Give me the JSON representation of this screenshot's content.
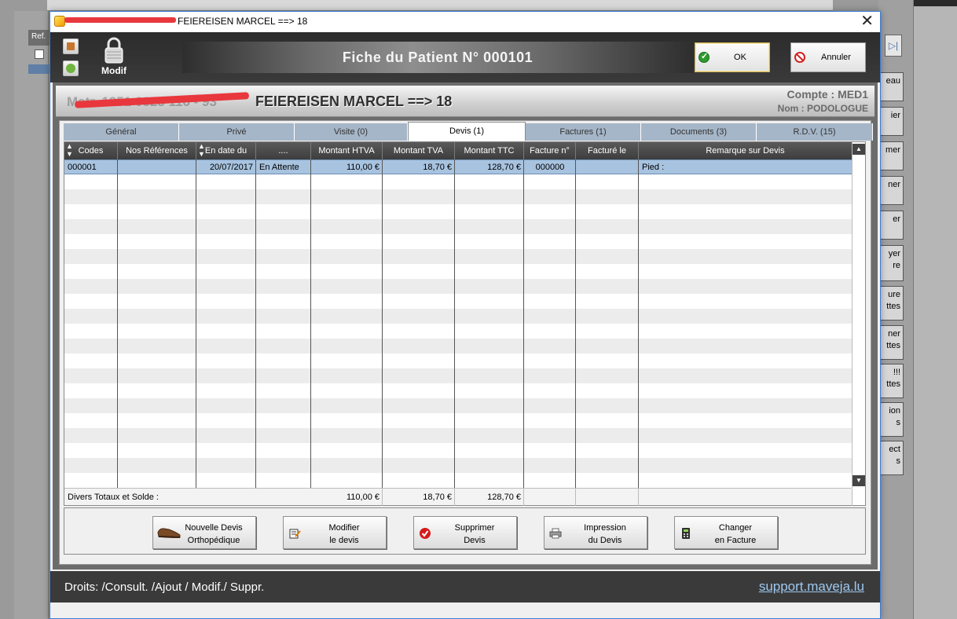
{
  "background": {
    "ref_tab": "Ref.",
    "nav_icon": "last-page-icon",
    "side_buttons": [
      {
        "line1": "eau",
        "line2": ""
      },
      {
        "line1": "ier",
        "line2": ""
      },
      {
        "line1": "mer",
        "line2": ""
      },
      {
        "line1": "ner",
        "line2": ""
      },
      {
        "line1": "er",
        "line2": ""
      },
      {
        "line1": "yer",
        "line2": "re"
      },
      {
        "line1": "ure",
        "line2": "ttes"
      },
      {
        "line1": "ner",
        "line2": "ttes"
      },
      {
        "line1": "!!!",
        "line2": "ttes"
      },
      {
        "line1": "ion",
        "line2": "s"
      },
      {
        "line1": "ect",
        "line2": "s"
      }
    ]
  },
  "window": {
    "title": "FEIEREISEN MARCEL ==> 18",
    "close": "✕"
  },
  "header": {
    "lock_label": "Modif",
    "banner": "Fiche du Patient N° 000101",
    "ok_label": "OK",
    "cancel_label": "Annuler"
  },
  "patient": {
    "ghost_prefix": "Matr. 1951 0823 116 - 93",
    "name": "FEIEREISEN MARCEL ==> 18",
    "compte": "Compte :  MED1",
    "nom": "Nom : PODOLOGUE"
  },
  "tabs": [
    "Général",
    "Privé",
    "Visite (0)",
    "Devis  (1)",
    "Factures (1)",
    "Documents (3)",
    "R.D.V. (15)"
  ],
  "grid": {
    "headers": [
      "Codes",
      "Nos Références",
      "En date du",
      "....",
      "Montant HTVA",
      "Montant TVA",
      "Montant TTC",
      "Facture n°",
      "Facturé le",
      "Remarque sur Devis"
    ],
    "rows": [
      [
        "000001",
        "",
        "20/07/2017",
        "En Attente",
        "110,00 €",
        "18,70 €",
        "128,70 €",
        "000000",
        "",
        "Pied :"
      ]
    ],
    "totals_label": "Divers Totaux et Solde :",
    "totals": {
      "htva": "110,00 €",
      "tva": "18,70 €",
      "ttc": "128,70 €"
    }
  },
  "actions": [
    {
      "line1": "Nouvelle Devis",
      "line2": "Orthopédique",
      "icon": "shoe-icon"
    },
    {
      "line1": "Modifier",
      "line2": "le devis",
      "icon": "edit-document-icon"
    },
    {
      "line1": "Supprimer",
      "line2": "Devis",
      "icon": "delete-check-icon"
    },
    {
      "line1": "Impression",
      "line2": "du Devis",
      "icon": "printer-icon"
    },
    {
      "line1": "Changer",
      "line2": "en Facture",
      "icon": "calculator-icon"
    }
  ],
  "footer": {
    "rights": "Droits: /Consult. /Ajout / Modif./ Suppr.",
    "support": "support.maveja.lu"
  }
}
